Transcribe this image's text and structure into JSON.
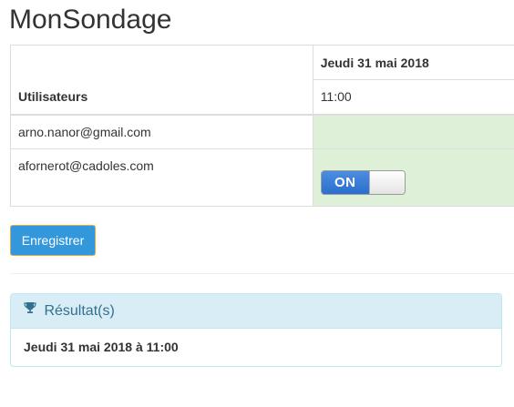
{
  "page": {
    "title": "MonSondage"
  },
  "poll_table": {
    "users_header": "Utilisateurs",
    "date_header": "Jeudi 31 mai 2018",
    "time_header": "11:00",
    "rows": [
      {
        "user": "arno.nanor@gmail.com",
        "vote": ""
      },
      {
        "user": "afornerot@cadoles.com",
        "vote_toggle": "ON",
        "toggle_state": "on"
      }
    ]
  },
  "actions": {
    "save_label": "Enregistrer"
  },
  "results": {
    "heading": "Résultat(s)",
    "icon": "trophy-icon",
    "winner": "Jeudi 31 mai 2018 à 11:00"
  },
  "colors": {
    "accent_button": "#3397db",
    "vote_cell": "#dff0d8",
    "toggle_on": "#2a6fcf",
    "panel_heading": "#d9edf7",
    "panel_text": "#31708f"
  }
}
